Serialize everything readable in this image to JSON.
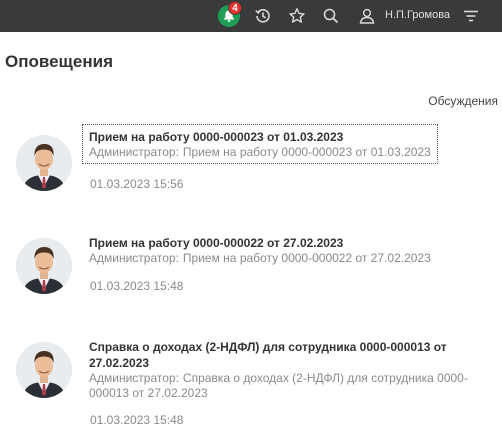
{
  "topbar": {
    "notification_count": "4",
    "username": "Н.П.Громова",
    "colors": {
      "background": "#3a3a3a",
      "bell": "#1f9e55",
      "badge": "#e8312f"
    },
    "icons": [
      "bell-icon",
      "history-icon",
      "star-icon",
      "search-icon",
      "user-icon",
      "menu-icon"
    ]
  },
  "page": {
    "title": "Оповещения",
    "discussions_link": "Обсуждения"
  },
  "notifications": [
    {
      "title": "Прием на работу 0000-000023 от 01.03.2023",
      "author": "Администратор:",
      "text": "Прием на работу 0000-000023 от 01.03.2023",
      "time": "01.03.2023 15:56"
    },
    {
      "title": "Прием на работу 0000-000022 от 27.02.2023",
      "author": "Администратор:",
      "text": "Прием на работу 0000-000022 от 27.02.2023",
      "time": "01.03.2023 15:48"
    },
    {
      "title": "Справка о доходах (2-НДФЛ) для сотрудника 0000-000013 от 27.02.2023",
      "author": "Администратор:",
      "text": "Справка о доходах (2-НДФЛ) для сотрудника 0000-000013 от 27.02.2023",
      "time": "01.03.2023 15:48"
    }
  ]
}
